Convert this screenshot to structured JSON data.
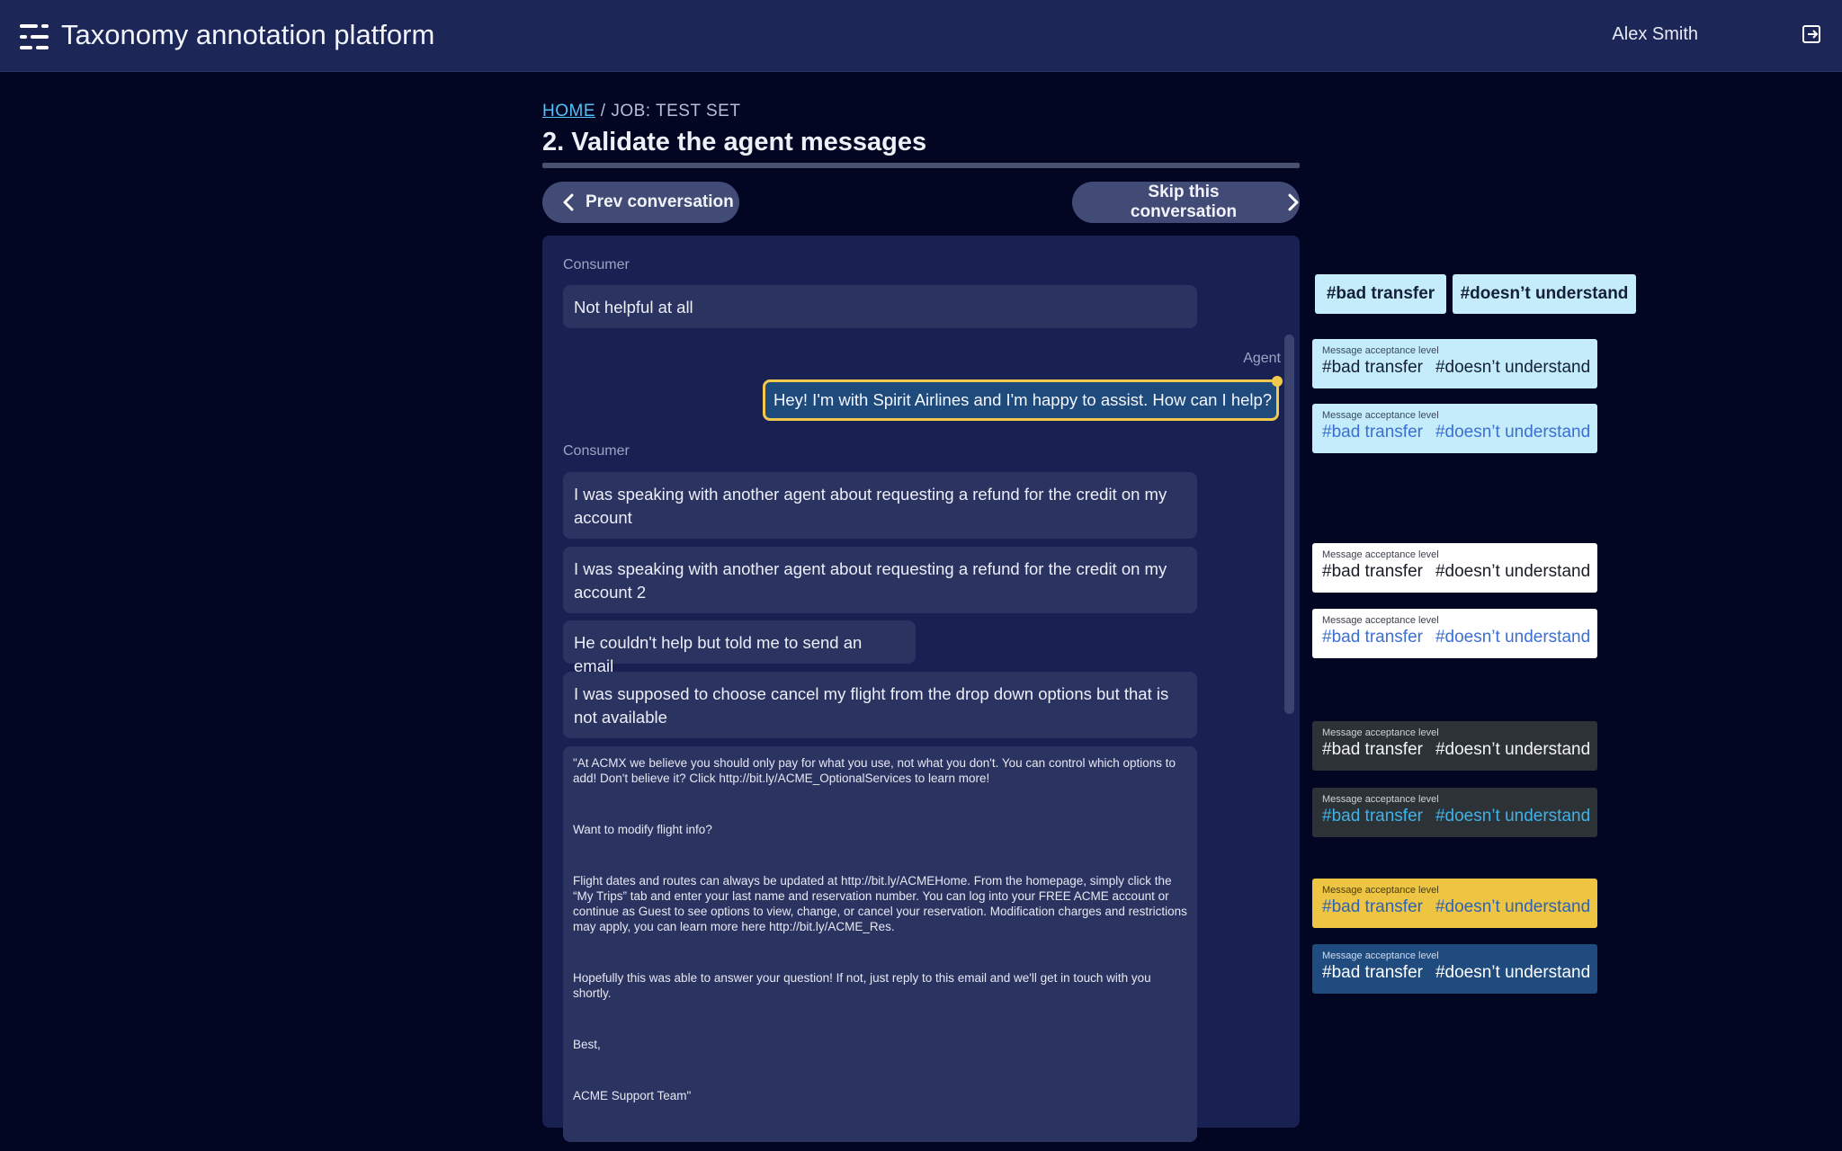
{
  "header": {
    "app_title": "Taxonomy annotation platform",
    "user_name": "Alex Smith",
    "logo_icon": "menu-logo-icon",
    "logout_icon": "logout-icon"
  },
  "breadcrumb": {
    "home": "HOME",
    "separator": "/",
    "job": "JOB: TEST SET"
  },
  "page": {
    "title": "2. Validate the agent messages"
  },
  "nav": {
    "prev": "Prev conversation",
    "next": "Skip this conversation"
  },
  "conversation": {
    "consumer_label": "Consumer",
    "agent_label": "Agent",
    "messages": [
      "Not helpful at all",
      "Hey! I'm with Spirit Airlines and I'm happy to assist. How can I help?",
      "I was speaking with another agent about requesting a refund for the credit on my account",
      "I was speaking with another agent about requesting a refund for the credit on my account 2",
      "He couldn't help but told me to send an email",
      "I was supposed to choose cancel my flight from the drop down options but that is not available"
    ],
    "long_message": [
      "\"At ACMX we believe you should only pay for what you use, not what you don't. You can control which options to add! Don't believe it? Click http://bit.ly/ACME_OptionalServices to learn more!",
      "Want to modify flight info?",
      "Flight dates and routes can always be updated at http://bit.ly/ACMEHome. From the homepage, simply click the “My Trips” tab and enter your last name and reservation number. You can log into your FREE ACME account or continue as Guest to see options to view, change, or cancel your reservation. Modification charges and restrictions may apply, you can learn more here http://bit.ly/ACME_Res.",
      "Hopefully this was able to answer your question! If not, just reply to this email and we'll get in touch with you shortly.",
      "Best,",
      "ACME Support Team\""
    ]
  },
  "tags": {
    "bad_transfer": "#bad transfer",
    "doesnt_understand": "#doesn’t understand",
    "card_label": "Message acceptance level"
  },
  "colors": {
    "background": "#020623",
    "header": "#1d2757",
    "highlight": "#f2c94c",
    "link": "#4fc3f7",
    "chip_light_blue": "#c4ecfa",
    "card_white": "#ffffff",
    "card_dark": "#2d3236",
    "card_yellow": "#eec542",
    "card_blue": "#1f4b7e"
  }
}
